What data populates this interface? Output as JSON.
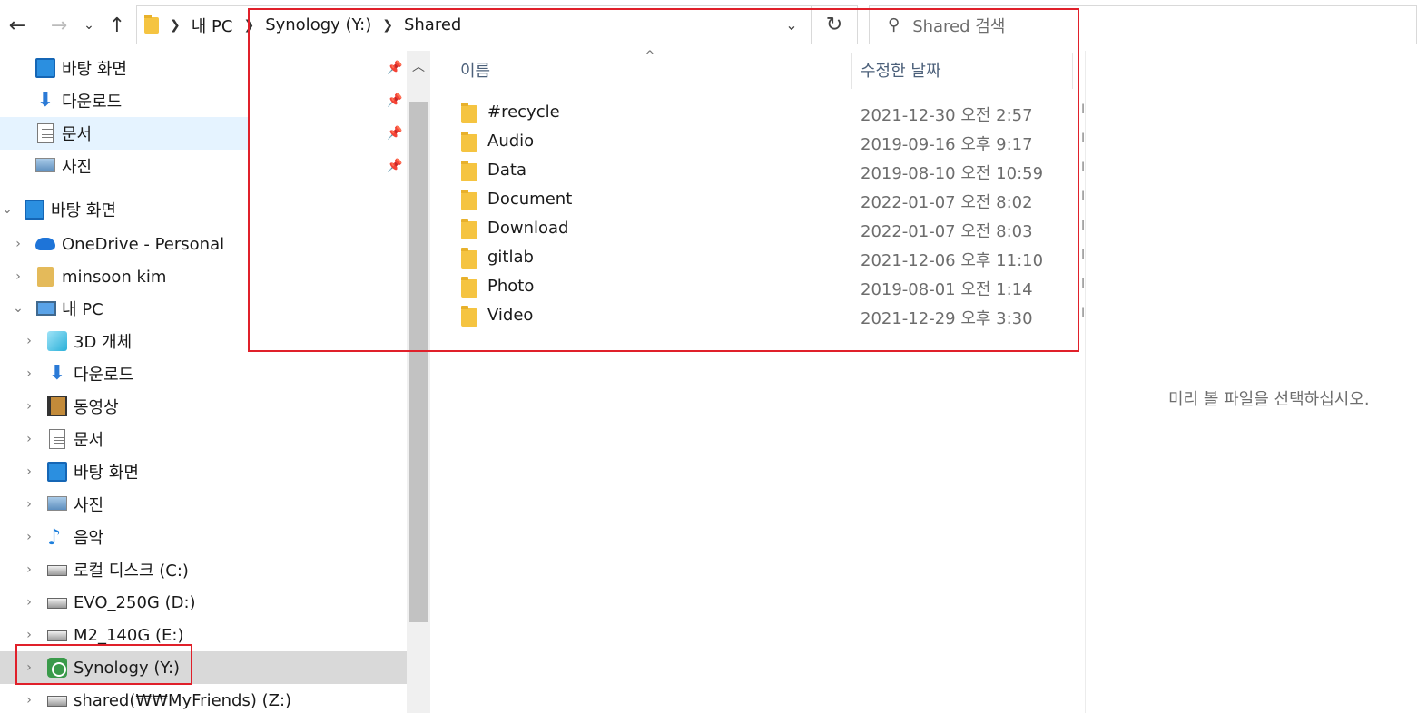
{
  "address_bar": {
    "crumbs": [
      "내 PC",
      "Synology (Y:)",
      "Shared"
    ],
    "search_placeholder": "Shared 검색"
  },
  "nav_pane": {
    "quick_access": [
      {
        "label": "바탕 화면",
        "icon": "desktop-icon"
      },
      {
        "label": "다운로드",
        "icon": "download-icon"
      },
      {
        "label": "문서",
        "icon": "document-icon"
      },
      {
        "label": "사진",
        "icon": "pictures-icon"
      }
    ],
    "tree": [
      {
        "label": "바탕 화면",
        "icon": "desktop-icon",
        "level": 0,
        "expanded": true
      },
      {
        "label": "OneDrive - Personal",
        "icon": "onedrive-icon",
        "level": 1,
        "expanded": false
      },
      {
        "label": "minsoon kim",
        "icon": "user-folder-icon",
        "level": 1,
        "expanded": false
      },
      {
        "label": "내 PC",
        "icon": "pc-icon",
        "level": 1,
        "expanded": true
      },
      {
        "label": "3D 개체",
        "icon": "3d-objects-icon",
        "level": 2
      },
      {
        "label": "다운로드",
        "icon": "download-icon",
        "level": 2
      },
      {
        "label": "동영상",
        "icon": "video-icon",
        "level": 2
      },
      {
        "label": "문서",
        "icon": "document-icon",
        "level": 2
      },
      {
        "label": "바탕 화면",
        "icon": "desktop-icon",
        "level": 2
      },
      {
        "label": "사진",
        "icon": "pictures-icon",
        "level": 2
      },
      {
        "label": "음악",
        "icon": "music-icon",
        "level": 2
      },
      {
        "label": "로컬 디스크 (C:)",
        "icon": "windows-drive-icon",
        "level": 2
      },
      {
        "label": "EVO_250G (D:)",
        "icon": "drive-icon",
        "level": 2
      },
      {
        "label": "M2_140G (E:)",
        "icon": "drive-icon",
        "level": 2
      },
      {
        "label": "Synology (Y:)",
        "icon": "synology-drive-icon",
        "level": 2,
        "selected": true
      },
      {
        "label": "shared(₩₩MyFriends) (Z:)",
        "icon": "network-drive-icon",
        "level": 2
      }
    ]
  },
  "content": {
    "columns": {
      "name": "이름",
      "modified": "수정한 날짜"
    },
    "files": [
      {
        "name": "#recycle",
        "modified": "2021-12-30 오전 2:57"
      },
      {
        "name": "Audio",
        "modified": "2019-09-16 오후 9:17"
      },
      {
        "name": "Data",
        "modified": "2019-08-10 오전 10:59"
      },
      {
        "name": "Document",
        "modified": "2022-01-07 오전 8:02"
      },
      {
        "name": "Download",
        "modified": "2022-01-07 오전 8:03"
      },
      {
        "name": "gitlab",
        "modified": "2021-12-06 오후 11:10"
      },
      {
        "name": "Photo",
        "modified": "2019-08-01 오전 1:14"
      },
      {
        "name": "Video",
        "modified": "2021-12-29 오후 3:30"
      }
    ]
  },
  "preview": {
    "message": "미리 볼 파일을 선택하십시오."
  },
  "colors": {
    "highlight_box": "#e0202a",
    "selection_bg": "#cce8ff",
    "hover_bg": "#d9d9d9"
  }
}
